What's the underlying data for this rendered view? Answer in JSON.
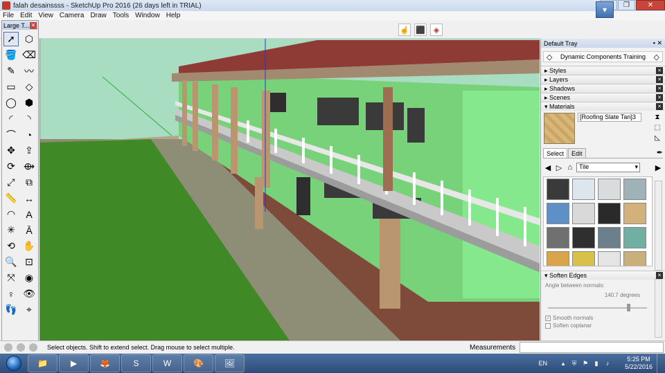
{
  "window": {
    "title": "falah desainssss - SketchUp Pro 2016 (26 days left in TRIAL)",
    "minimize_label": "—",
    "restore_label": "❐",
    "close_label": "✕"
  },
  "menu": [
    "File",
    "Edit",
    "View",
    "Camera",
    "Draw",
    "Tools",
    "Window",
    "Help"
  ],
  "toolbar": {
    "tools": [
      "hand-arrow-icon",
      "components-icon",
      "styles-icon"
    ],
    "maximize_label": "▾"
  },
  "large_tools": {
    "title": "Large T...",
    "close": "✕",
    "tools": [
      {
        "icon": "select-icon",
        "glyph": "➚"
      },
      {
        "icon": "make-component-icon",
        "glyph": "⬡"
      },
      {
        "icon": "paint-bucket-icon",
        "glyph": "🪣"
      },
      {
        "icon": "eraser-icon",
        "glyph": "⌫"
      },
      {
        "icon": "line-icon",
        "glyph": "✎"
      },
      {
        "icon": "freehand-icon",
        "glyph": "〰"
      },
      {
        "icon": "rectangle-icon",
        "glyph": "▭"
      },
      {
        "icon": "rotated-rectangle-icon",
        "glyph": "◇"
      },
      {
        "icon": "circle-icon",
        "glyph": "◯"
      },
      {
        "icon": "polygon-icon",
        "glyph": "⬢"
      },
      {
        "icon": "arc-icon",
        "glyph": "◜"
      },
      {
        "icon": "three-point-arc-icon",
        "glyph": "◝"
      },
      {
        "icon": "two-point-arc-icon",
        "glyph": "⌒"
      },
      {
        "icon": "pie-icon",
        "glyph": "◔"
      },
      {
        "icon": "move-icon",
        "glyph": "✥"
      },
      {
        "icon": "push-pull-icon",
        "glyph": "⇪"
      },
      {
        "icon": "rotate-icon",
        "glyph": "⟳"
      },
      {
        "icon": "follow-me-icon",
        "glyph": "⟴"
      },
      {
        "icon": "scale-icon",
        "glyph": "⤢"
      },
      {
        "icon": "offset-icon",
        "glyph": "⧉"
      },
      {
        "icon": "tape-measure-icon",
        "glyph": "📏"
      },
      {
        "icon": "dimension-icon",
        "glyph": "↔"
      },
      {
        "icon": "protractor-icon",
        "glyph": "◠"
      },
      {
        "icon": "text-icon",
        "glyph": "A"
      },
      {
        "icon": "axes-icon",
        "glyph": "✳"
      },
      {
        "icon": "3d-text-icon",
        "glyph": "Ā"
      },
      {
        "icon": "orbit-icon",
        "glyph": "⟲"
      },
      {
        "icon": "pan-icon",
        "glyph": "✋"
      },
      {
        "icon": "zoom-icon",
        "glyph": "🔍"
      },
      {
        "icon": "zoom-window-icon",
        "glyph": "⊡"
      },
      {
        "icon": "zoom-extents-icon",
        "glyph": "⤧"
      },
      {
        "icon": "previous-view-icon",
        "glyph": "◉"
      },
      {
        "icon": "position-camera-icon",
        "glyph": "♀"
      },
      {
        "icon": "look-around-icon",
        "glyph": "👁"
      },
      {
        "icon": "walk-icon",
        "glyph": "👣"
      },
      {
        "icon": "section-plane-icon",
        "glyph": "⌖"
      }
    ]
  },
  "tray": {
    "title": "Default Tray",
    "pin": "▪ ✕",
    "dynamic_components": "Dynamic Components Training",
    "panels": [
      {
        "label": "▸ Styles",
        "expanded": false
      },
      {
        "label": "▸ Layers",
        "expanded": false
      },
      {
        "label": "▸ Shadows",
        "expanded": false
      },
      {
        "label": "▸ Scenes",
        "expanded": false
      },
      {
        "label": "▾ Materials",
        "expanded": true
      }
    ],
    "materials": {
      "current_name": "[Roofing Slate Tan]3",
      "tabs": [
        "Select",
        "Edit"
      ],
      "library": "Tile",
      "swatch_colors": [
        "#3a3a3a",
        "#dde6ee",
        "#d9dcdc",
        "#9fb2b8",
        "#5f8fc7",
        "#d9d9d9",
        "#2a2a2a",
        "#d2b27a",
        "#707070",
        "#2f2f2f",
        "#6c7f8c",
        "#6fb0a2",
        "#d9a44a",
        "#d8c049",
        "#e5e5e5",
        "#c9b07a"
      ]
    },
    "soften": {
      "label": "▾ Soften Edges",
      "angle_label": "Angle between normals:",
      "angle_value": "140.7",
      "angle_unit": "degrees",
      "smooth_normals": "Smooth normals",
      "soften_coplanar": "Soften coplanar"
    }
  },
  "status": {
    "text": "Select objects. Shift to extend select. Drag mouse to select multiple.",
    "measurements_label": "Measurements"
  },
  "taskbar": {
    "apps": [
      "explorer-icon",
      "media-player-icon",
      "firefox-icon",
      "sketchup-icon",
      "word-icon",
      "paint-icon",
      "photo-viewer-icon"
    ],
    "app_glyphs": [
      "📁",
      "▶",
      "🦊",
      "S",
      "W",
      "🎨",
      "🖼"
    ],
    "language": "EN",
    "time": "5:25 PM",
    "date": "5/22/2016"
  }
}
